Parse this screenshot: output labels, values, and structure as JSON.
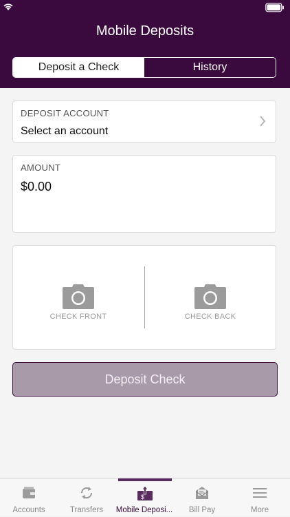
{
  "header": {
    "title": "Mobile Deposits",
    "tabs": [
      {
        "label": "Deposit a Check",
        "active": true
      },
      {
        "label": "History",
        "active": false
      }
    ]
  },
  "form": {
    "deposit_account": {
      "label": "DEPOSIT ACCOUNT",
      "value": "Select an account"
    },
    "amount": {
      "label": "AMOUNT",
      "value": "$0.00"
    },
    "photos": {
      "front_label": "CHECK FRONT",
      "back_label": "CHECK BACK"
    },
    "submit_label": "Deposit Check"
  },
  "tabbar": {
    "items": [
      {
        "label": "Accounts",
        "icon": "wallet-icon"
      },
      {
        "label": "Transfers",
        "icon": "transfer-icon"
      },
      {
        "label": "Mobile Deposi...",
        "icon": "mobile-deposit-icon",
        "active": true
      },
      {
        "label": "Bill Pay",
        "icon": "bill-pay-icon"
      },
      {
        "label": "More",
        "icon": "menu-icon"
      }
    ]
  },
  "colors": {
    "brand": "#3a0a3e",
    "button_disabled": "#a89aa9"
  }
}
